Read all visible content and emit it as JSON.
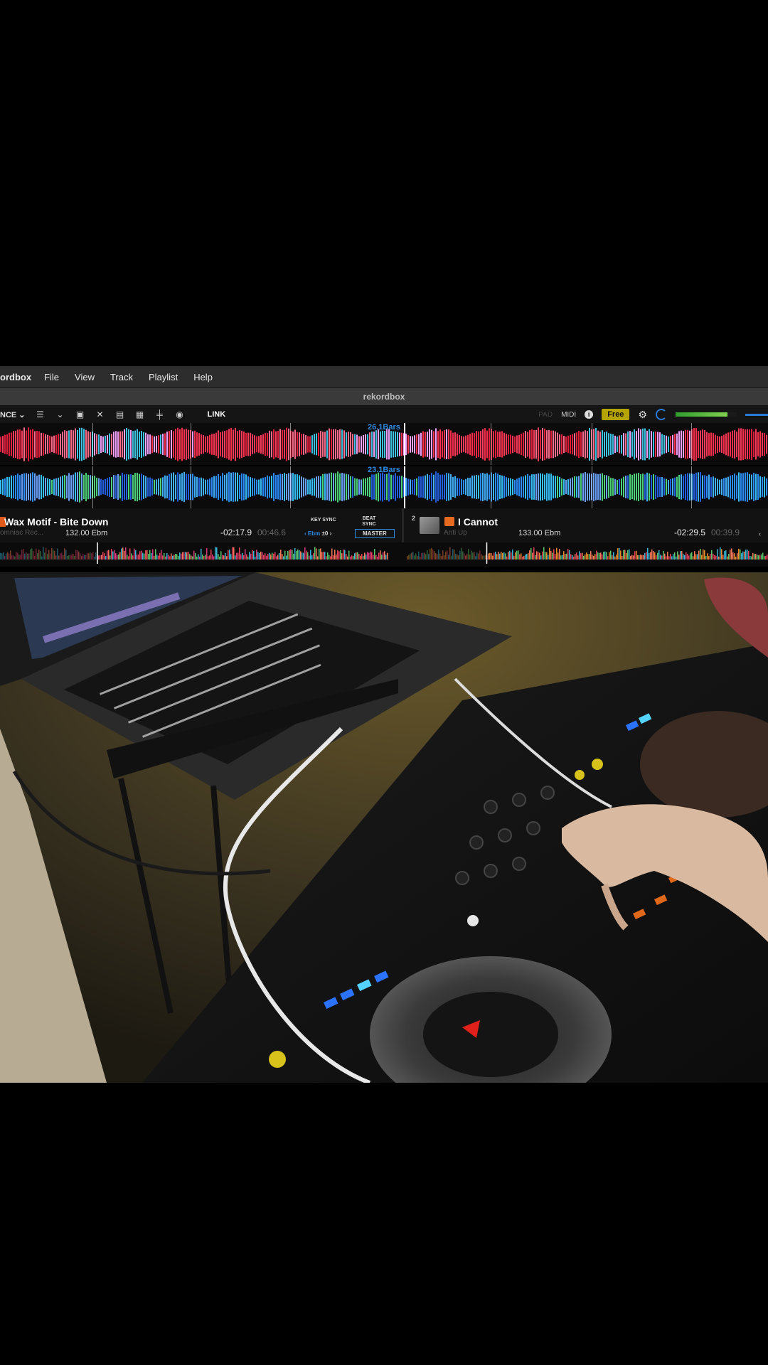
{
  "menubar": {
    "app_name": "ordbox",
    "items": [
      "File",
      "View",
      "Track",
      "Playlist",
      "Help"
    ]
  },
  "window": {
    "title": "rekordbox"
  },
  "toolbar": {
    "layout_label": "NCE",
    "link_label": "LINK",
    "pad_label": "PAD",
    "midi_label": "MIDI",
    "info_label": "i",
    "free_label": "Free",
    "master_level": 0.85
  },
  "waveforms": {
    "deck1_bars": "26.1Bars",
    "deck2_bars": "23.1Bars"
  },
  "deck1": {
    "title": "Wax Motif - Bite Down",
    "artist": "omniac Rec...",
    "bpm_key": "132.00 Ebm",
    "remain": "-02:17.9",
    "elapsed": "00:46.6",
    "key_sync_label": "KEY SYNC",
    "beat_sync_label": "BEAT SYNC",
    "key_prev": "‹",
    "key_value": "Ebm",
    "key_offset": "±0",
    "key_next": "›",
    "master_label": "MASTER",
    "progress": 0.25
  },
  "deck2": {
    "number": "2",
    "title": "I Cannot",
    "artist": "Anti Up",
    "bpm_key": "133.00 Ebm",
    "remain": "-02:29.5",
    "elapsed": "00:39.9",
    "chevron": "‹",
    "progress": 0.22
  },
  "colors": {
    "accent_blue": "#2e8be0",
    "free_badge": "#b5a300",
    "deck_orange": "#e05a1b"
  }
}
